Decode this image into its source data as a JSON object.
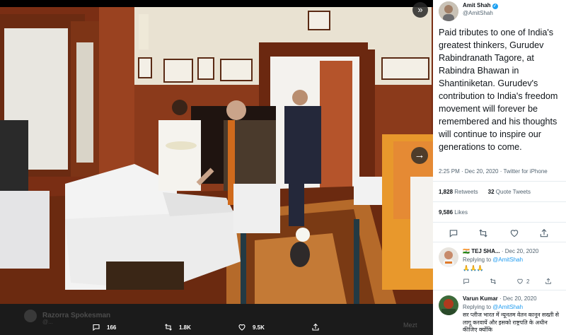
{
  "viewer": {
    "photo_alt": "",
    "collapse_icon": "chevron-double-right-icon",
    "next_icon": "arrow-right-icon",
    "background_tweet": {
      "name": "Razorra Spokesman",
      "handle": "@...",
      "text": "",
      "partial_word": "Mezt"
    },
    "actions": {
      "reply_count": "166",
      "retweet_count": "1.8K",
      "like_count": "9.5K"
    }
  },
  "tweet": {
    "author_name": "Amit Shah",
    "author_handle": "@AmitShah",
    "text": "Paid tributes to one of India's greatest thinkers, Gurudev Rabindranath Tagore, at Rabindra Bhawan in Shantiniketan. Gurudev's contribution to India's freedom movement will forever be remembered and his thoughts will continue to inspire our generations to come.",
    "time": "2:25 PM",
    "date": "Dec 20, 2020",
    "source": "Twitter for iPhone",
    "retweets": "1,828",
    "retweets_label": "Retweets",
    "quotes": "32",
    "quotes_label": "Quote Tweets",
    "likes": "9,586",
    "likes_label": "Likes"
  },
  "replies": [
    {
      "flag": "🇮🇳",
      "name": "TEJ SHA...",
      "date": "Dec 20, 2020",
      "replying_prefix": "Replying to",
      "replying_to": "@AmitShah",
      "body": "🙏🙏🙏",
      "like_count": "2"
    },
    {
      "name": "Varun Kumar",
      "date": "Dec 20, 2020",
      "replying_prefix": "Replying to",
      "replying_to": "@AmitShah",
      "body": "सर प्लीज भारत में न्यूनतम वेतन कानून सख्ती से लागू करवायें और इसको राष्ट्रपति के अधीन कीजिए क्योंकि"
    }
  ],
  "colors": {
    "accent": "#1d9bf0",
    "verified": "#1da1f2",
    "text": "#0f1419",
    "muted": "#536471"
  }
}
